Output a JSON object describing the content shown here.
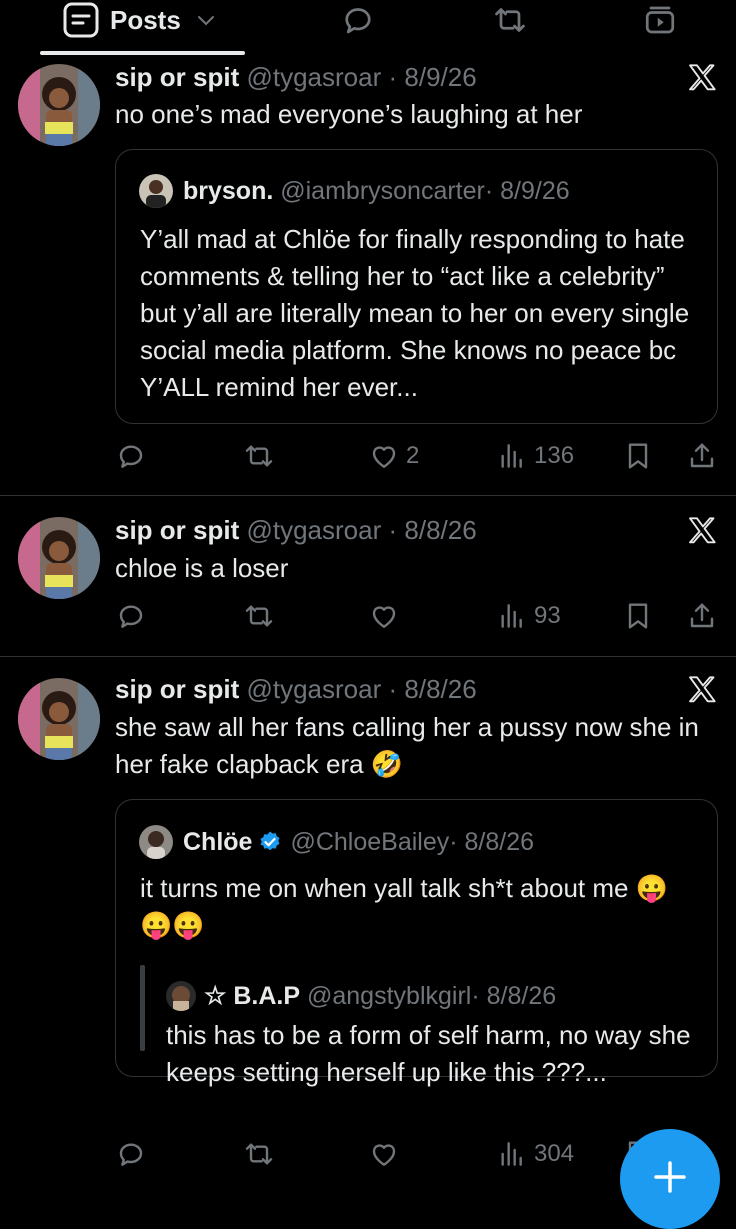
{
  "header": {
    "active_tab": "Posts"
  },
  "icons": {
    "posts_tab": "posts-tab-icon",
    "chevron": "chevron-down-icon",
    "reply": "reply-icon",
    "repost": "repost-icon",
    "like": "like-icon",
    "views": "views-icon",
    "bookmark": "bookmark-icon",
    "share": "share-icon",
    "video": "video-tab-icon",
    "x_logo": "x-logo",
    "compose": "compose-plus-icon",
    "verified": "verified-badge-icon"
  },
  "colors": {
    "background": "#000000",
    "text": "#e7e9ea",
    "muted": "#71767b",
    "accent": "#1d9bf0",
    "border": "#2f3336"
  },
  "posts": [
    {
      "name": "sip or spit",
      "handle": "@tygasroar",
      "date": "· 8/9/26",
      "text": "no one’s mad everyone’s laughing at her",
      "quote": {
        "name": "bryson.",
        "handle": "@iambrysoncarter",
        "date": "· 8/9/26",
        "text": "Y’all mad at Chlöe for finally responding to hate comments & telling her to “act like a celebrity” but y’all are literally mean to her on every single social media platform. She knows no peace bc Y’ALL remind her ever..."
      },
      "likes": "2",
      "views": "136"
    },
    {
      "name": "sip or spit",
      "handle": "@tygasroar",
      "date": "· 8/8/26",
      "text": "chloe is a loser",
      "views": "93"
    },
    {
      "name": "sip or spit",
      "handle": "@tygasroar",
      "date": "· 8/8/26",
      "text": "she saw all her fans calling her a pussy now she in her fake clapback era 🤣",
      "quote": {
        "name": "Chlöe",
        "handle": "@ChloeBailey",
        "date": "· 8/8/26",
        "text": "it turns me on when yall talk sh*t about me 😛😛😛",
        "inner_quote": {
          "name": "☆ B.A.P",
          "handle": "@angstyblkgirl",
          "date": "· 8/8/26",
          "text": "this has to be a form of self harm, no way she keeps setting herself up like this ???..."
        }
      },
      "views": "304"
    }
  ]
}
